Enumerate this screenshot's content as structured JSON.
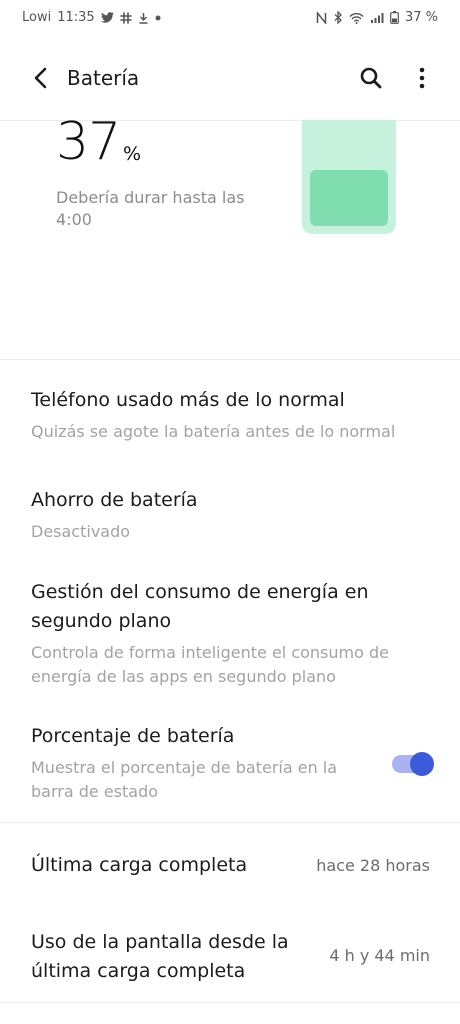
{
  "status_bar": {
    "carrier": "Lowi",
    "time": "11:35",
    "battery_percent": "37 %"
  },
  "app_bar": {
    "title": "Batería"
  },
  "battery": {
    "percent_value": "37",
    "percent_symbol": "%",
    "duration_text": "Debería durar hasta las 4:00",
    "level": 0.37,
    "shell_color": "#c6f1dc",
    "fill_color": "#7fddb0"
  },
  "settings": {
    "phone_usage": {
      "title": "Teléfono usado más de lo normal",
      "subtitle": "Quizás se agote la batería antes de lo normal"
    },
    "battery_saver": {
      "title": "Ahorro de batería",
      "subtitle": "Desactivado"
    },
    "background_power": {
      "title": "Gestión del consumo de energía en segundo plano",
      "subtitle": "Controla de forma inteligente el consumo de energía de las apps en segundo plano"
    },
    "battery_percentage": {
      "title": "Porcentaje de batería",
      "subtitle": "Muestra el porcentaje de batería en la barra de estado",
      "enabled": true
    },
    "last_full_charge": {
      "title": "Última carga completa",
      "value": "hace 28 horas"
    },
    "screen_usage": {
      "title": "Uso de la pantalla desde la última carga completa",
      "value": "4 h y 44 min"
    }
  },
  "colors": {
    "accent": "#3b5bdb",
    "accent_track": "#a9b3f3"
  }
}
